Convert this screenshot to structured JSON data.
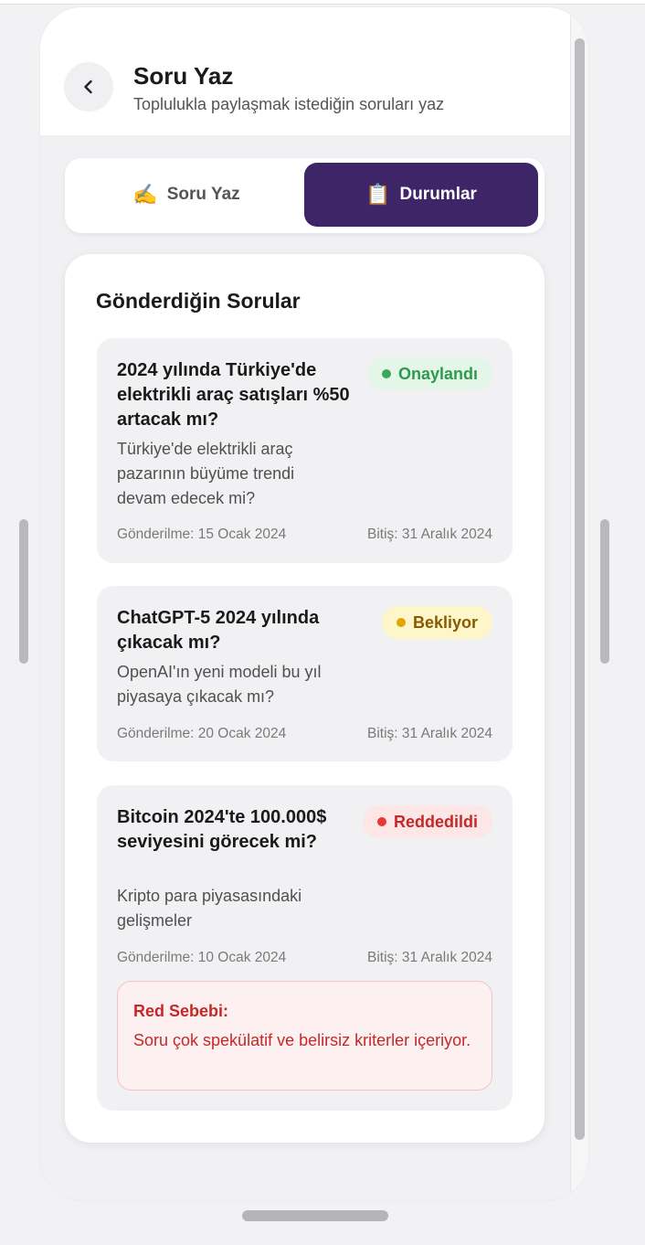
{
  "header": {
    "title": "Soru Yaz",
    "subtitle": "Toplulukla paylaşmak istediğin soruları yaz",
    "back_icon": "chevron-left-icon"
  },
  "tabs": [
    {
      "emoji": "✍️",
      "label": "Soru Yaz",
      "active": false
    },
    {
      "emoji": "📋",
      "label": "Durumlar",
      "active": true
    }
  ],
  "submissions": {
    "title": "Gönderdiğin Sorular",
    "items": [
      {
        "title": "2024 yılında Türkiye'de elektrikli araç satışları %50 artacak mı?",
        "description": "Türkiye'de elektrikli araç pazarının büyüme trendi devam edecek mi?",
        "submitted": "Gönderilme: 15 Ocak 2024",
        "ends": "Bitiş: 31 Aralık 2024",
        "status": "Onaylandı",
        "status_color": "#2e9a4e",
        "status_bg": "#e3f6e7"
      },
      {
        "title": "ChatGPT-5 2024 yılında çıkacak mı?",
        "description": "OpenAI'ın yeni modeli bu yıl piyasaya çıkacak mı?",
        "submitted": "Gönderilme: 20 Ocak 2024",
        "ends": "Bitiş: 31 Aralık 2024",
        "status": "Bekliyor",
        "status_color": "#8a5a00",
        "status_bg": "#fdf6c8",
        "dot_color": "#e0a500"
      },
      {
        "title": "Bitcoin 2024'te 100.000$ seviyesini görecek mi?",
        "description": "Kripto para piyasasındaki gelişmeler",
        "submitted": "Gönderilme: 10 Ocak 2024",
        "ends": "Bitiş: 31 Aralık 2024",
        "status": "Reddedildi",
        "status_color": "#c62828",
        "status_bg": "#fde6e6",
        "reason_title": "Red Sebebi:",
        "reason_text": "Soru çok spekülatif ve belirsiz kriterler içeriyor."
      }
    ]
  },
  "colors": {
    "accent": "#3d2568",
    "approved": "#2e9a4e",
    "pending": "#e0a500",
    "rejected": "#c62828"
  }
}
